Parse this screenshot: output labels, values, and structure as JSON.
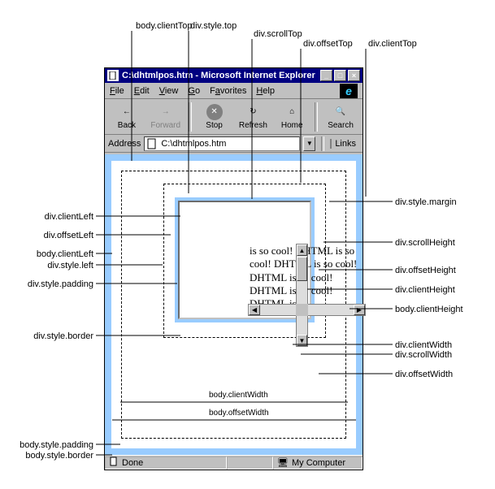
{
  "callouts_top": {
    "body_clientTop": "body.clientTop",
    "div_style_top": "div.style.top",
    "div_scrollTop": "div.scrollTop",
    "div_offsetTop": "div.offsetTop",
    "div_clientTop": "div.clientTop"
  },
  "callouts_left": {
    "div_clientLeft": "div.clientLeft",
    "div_offsetLeft": "div.offsetLeft",
    "body_clientLeft": "body.clientLeft",
    "div_style_left": "div.style.left",
    "div_style_padding": "div.style.padding",
    "div_style_border": "div.style.border",
    "body_style_padding": "body.style.padding",
    "body_style_border": "body.style.border"
  },
  "callouts_right": {
    "div_style_margin": "div.style.margin",
    "div_scrollHeight": "div.scrollHeight",
    "div_offsetHeight": "div.offsetHeight",
    "div_clientHeight": "div.clientHeight",
    "body_clientHeight": "body.clientHeight",
    "div_clientWidth": "div.clientWidth",
    "div_scrollWidth": "div.scrollWidth",
    "div_offsetWidth": "div.offsetWidth"
  },
  "dims": {
    "body_clientWidth": "body.clientWidth",
    "body_offsetWidth": "body.offsetWidth"
  },
  "window": {
    "title": "C:\\dhtmlpos.htm - Microsoft Internet Explorer",
    "min": "_",
    "max": "□",
    "close": "×"
  },
  "menu": {
    "file": "File",
    "edit": "Edit",
    "view": "View",
    "go": "Go",
    "favorites": "Favorites",
    "help": "Help",
    "logo": "e"
  },
  "toolbar": {
    "back": "Back",
    "forward": "Forward",
    "stop": "Stop",
    "refresh": "Refresh",
    "home": "Home",
    "search": "Search"
  },
  "address": {
    "label": "Address",
    "value": "C:\\dhtmlpos.htm",
    "links": "Links"
  },
  "content": {
    "text": "is so cool! DHTML is so cool! DHTML is so cool! DHTML is so cool! DHTML is so cool! DHTML is"
  },
  "status": {
    "done": "Done",
    "zone": "My Computer"
  },
  "icons": {
    "page": "page-icon",
    "back": "←",
    "forward": "→",
    "stop": "✕",
    "refresh": "↻",
    "home": "⌂",
    "search": "🔍",
    "drop": "▼",
    "up": "▲",
    "down": "▼",
    "left": "◀",
    "right": "▶",
    "computer": "🖥"
  }
}
